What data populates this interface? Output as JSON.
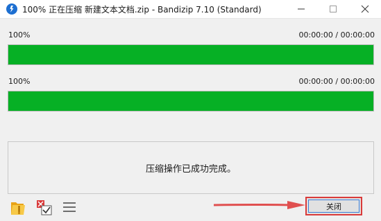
{
  "window": {
    "title": "100% 正在压缩 新建文本文档.zip - Bandizip 7.10 (Standard)"
  },
  "file_progress": {
    "percent_label": "100%",
    "time_label": "00:00:00 / 00:00:00",
    "value": 1.0
  },
  "total_progress": {
    "percent_label": "100%",
    "time_label": "00:00:00 / 00:00:00",
    "value": 1.0
  },
  "status": {
    "message": "压缩操作已成功完成。"
  },
  "toolbar": {
    "icons": [
      "open-folder-icon",
      "cancel-check-icon",
      "menu-icon"
    ],
    "close_label": "关闭"
  },
  "colors": {
    "progress_fill": "#06b025",
    "highlight": "#d93a3a"
  }
}
